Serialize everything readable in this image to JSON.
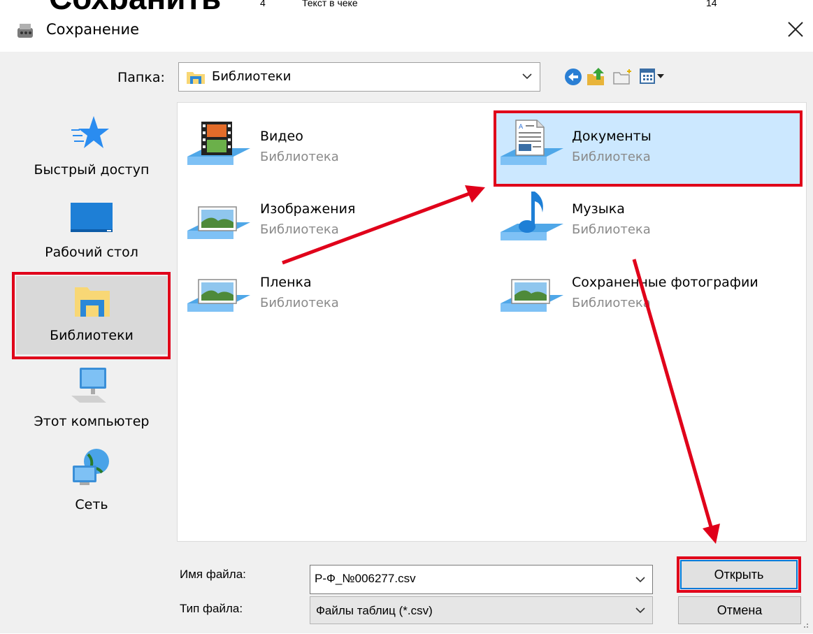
{
  "background": {
    "partial_heading": "Сохранить",
    "row_number": "4",
    "row_text": "Текст в чеке",
    "row_value": "14"
  },
  "dialog": {
    "title": "Сохранение",
    "close_symbol": "✕"
  },
  "folder_bar": {
    "label": "Папка:",
    "current": "Библиотеки",
    "toolbar_icons": [
      "back-icon",
      "up-folder-icon",
      "new-folder-icon",
      "view-menu-icon"
    ]
  },
  "places": [
    {
      "label": "Быстрый доступ",
      "icon": "quick-access-star-icon"
    },
    {
      "label": "Рабочий стол",
      "icon": "desktop-icon"
    },
    {
      "label": "Библиотеки",
      "icon": "libraries-icon",
      "selected": true
    },
    {
      "label": "Этот компьютер",
      "icon": "computer-icon"
    },
    {
      "label": "Сеть",
      "icon": "network-icon"
    }
  ],
  "libraries": [
    {
      "name": "Видео",
      "type": "Библиотека",
      "icon": "video-library-icon"
    },
    {
      "name": "Документы",
      "type": "Библиотека",
      "icon": "documents-library-icon",
      "selected": true
    },
    {
      "name": "Изображения",
      "type": "Библиотека",
      "icon": "pictures-library-icon"
    },
    {
      "name": "Музыка",
      "type": "Библиотека",
      "icon": "music-library-icon"
    },
    {
      "name": "Пленка",
      "type": "Библиотека",
      "icon": "camera-roll-library-icon"
    },
    {
      "name": "Сохраненные фотографии",
      "type": "Библиотека",
      "icon": "saved-pictures-library-icon"
    }
  ],
  "filename": {
    "label": "Имя файла:",
    "value": "Р-Ф_№006277.csv"
  },
  "filetype": {
    "label": "Тип файла:",
    "value": "Файлы таблиц (*.csv)"
  },
  "buttons": {
    "open": "Открыть",
    "cancel": "Отмена"
  },
  "colors": {
    "annotation_red": "#e0001a",
    "selection_blue": "#cce8ff",
    "dialog_bg": "#f0f0f0"
  }
}
